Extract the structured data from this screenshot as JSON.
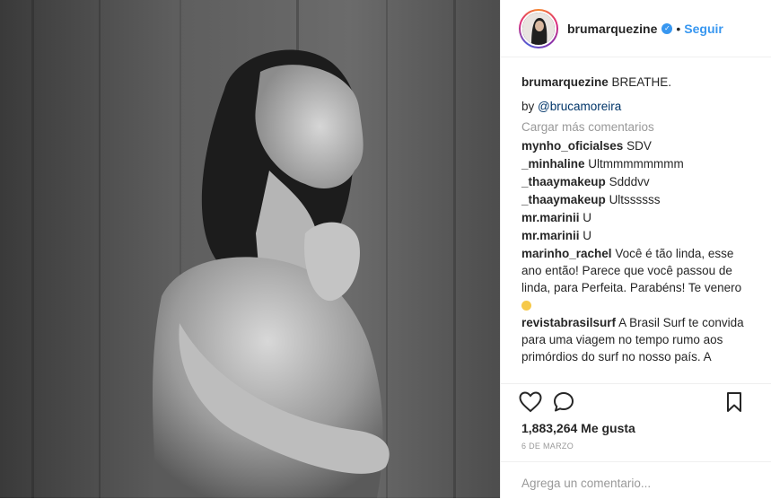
{
  "header": {
    "username": "brumarquezine",
    "follow_label": "Seguir",
    "separator": "•"
  },
  "caption": {
    "username": "brumarquezine",
    "text": "BREATHE."
  },
  "byline": {
    "prefix": "by",
    "mention": "@brucamoreira"
  },
  "load_more_label": "Cargar más comentarios",
  "comments": [
    {
      "user": "mynho_oficialses",
      "text": "SDV"
    },
    {
      "user": "_minhaline",
      "text": "Ultmmmmmmmm"
    },
    {
      "user": "_thaaymakeup",
      "text": "Sdddvv"
    },
    {
      "user": "_thaaymakeup",
      "text": "Ultssssss"
    },
    {
      "user": "mr.marinii",
      "text": "U"
    },
    {
      "user": "mr.marinii",
      "text": "U"
    },
    {
      "user": "marinho_rachel",
      "text": "Você é tão linda, esse ano então! Parece que você passou de linda, para Perfeita. Parabéns! Te venero"
    },
    {
      "user": "revistabrasilsurf",
      "text": "A Brasil Surf te convida para uma viagem no tempo rumo aos primórdios do surf no nosso país. A"
    }
  ],
  "icons": {
    "like": "heart-outline-icon",
    "comment": "speech-bubble-icon",
    "save": "bookmark-icon",
    "verified": "verified-badge-icon",
    "emoji": "smiling-face-emoji"
  },
  "likes_label": "1,883,264 Me gusta",
  "date_label": "6 DE MARZO",
  "add_comment": {
    "placeholder": "Agrega un comentario..."
  },
  "colors": {
    "link": "#3897f0",
    "muted": "#999999",
    "text": "#262626"
  }
}
